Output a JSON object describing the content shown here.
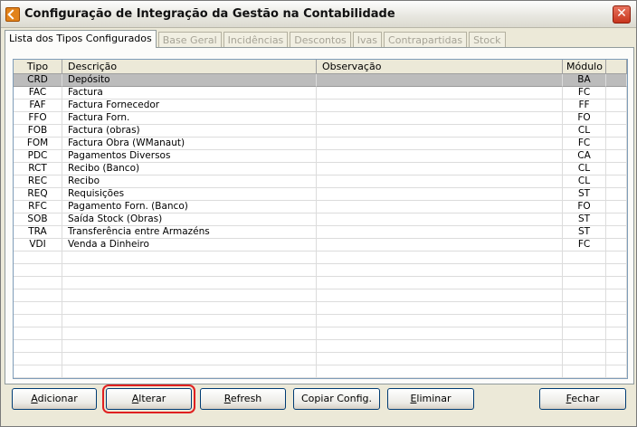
{
  "window": {
    "title": "Configuração de Integração da Gestão na Contabilidade",
    "close_label": "✕"
  },
  "tabs": [
    {
      "label": "Lista dos Tipos Configurados",
      "active": true
    },
    {
      "label": "Base Geral",
      "active": false
    },
    {
      "label": "Incidências",
      "active": false
    },
    {
      "label": "Descontos",
      "active": false
    },
    {
      "label": "Ivas",
      "active": false
    },
    {
      "label": "Contrapartidas",
      "active": false
    },
    {
      "label": "Stock",
      "active": false
    }
  ],
  "grid": {
    "columns": {
      "tipo": "Tipo",
      "descricao": "Descrição",
      "observacao": "Observação",
      "modulo": "Módulo"
    },
    "rows": [
      {
        "tipo": "CRD",
        "descricao": "Depósito",
        "observacao": "",
        "modulo": "BA",
        "selected": true
      },
      {
        "tipo": "FAC",
        "descricao": "Factura",
        "observacao": "",
        "modulo": "FC"
      },
      {
        "tipo": "FAF",
        "descricao": "Factura Fornecedor",
        "observacao": "",
        "modulo": "FF"
      },
      {
        "tipo": "FFO",
        "descricao": "Factura Forn.",
        "observacao": "",
        "modulo": "FO"
      },
      {
        "tipo": "FOB",
        "descricao": "Factura (obras)",
        "observacao": "",
        "modulo": "CL"
      },
      {
        "tipo": "FOM",
        "descricao": "Factura Obra (WManaut)",
        "observacao": "",
        "modulo": "FC"
      },
      {
        "tipo": "PDC",
        "descricao": "Pagamentos Diversos",
        "observacao": "",
        "modulo": "CA"
      },
      {
        "tipo": "RCT",
        "descricao": "Recibo (Banco)",
        "observacao": "",
        "modulo": "CL"
      },
      {
        "tipo": "REC",
        "descricao": "Recibo",
        "observacao": "",
        "modulo": "CL"
      },
      {
        "tipo": "REQ",
        "descricao": "Requisições",
        "observacao": "",
        "modulo": "ST"
      },
      {
        "tipo": "RFC",
        "descricao": "Pagamento Forn. (Banco)",
        "observacao": "",
        "modulo": "FO"
      },
      {
        "tipo": "SOB",
        "descricao": "Saída Stock (Obras)",
        "observacao": "",
        "modulo": "ST"
      },
      {
        "tipo": "TRA",
        "descricao": "Transferência entre Armazéns",
        "observacao": "",
        "modulo": "ST"
      },
      {
        "tipo": "VDI",
        "descricao": "Venda a Dinheiro",
        "observacao": "",
        "modulo": "FC"
      }
    ]
  },
  "buttons": {
    "adicionar": {
      "mnemonic": "A",
      "rest": "dicionar"
    },
    "alterar": {
      "mnemonic": "A",
      "rest": "lterar"
    },
    "refresh": {
      "mnemonic": "R",
      "rest": "efresh"
    },
    "copiar": {
      "label": "Copiar Config."
    },
    "eliminar": {
      "mnemonic": "E",
      "rest": "liminar"
    },
    "fechar": {
      "mnemonic": "F",
      "rest": "echar"
    }
  },
  "colors": {
    "highlight_outline": "#e02020",
    "selected_row": "#bcbcbc"
  }
}
